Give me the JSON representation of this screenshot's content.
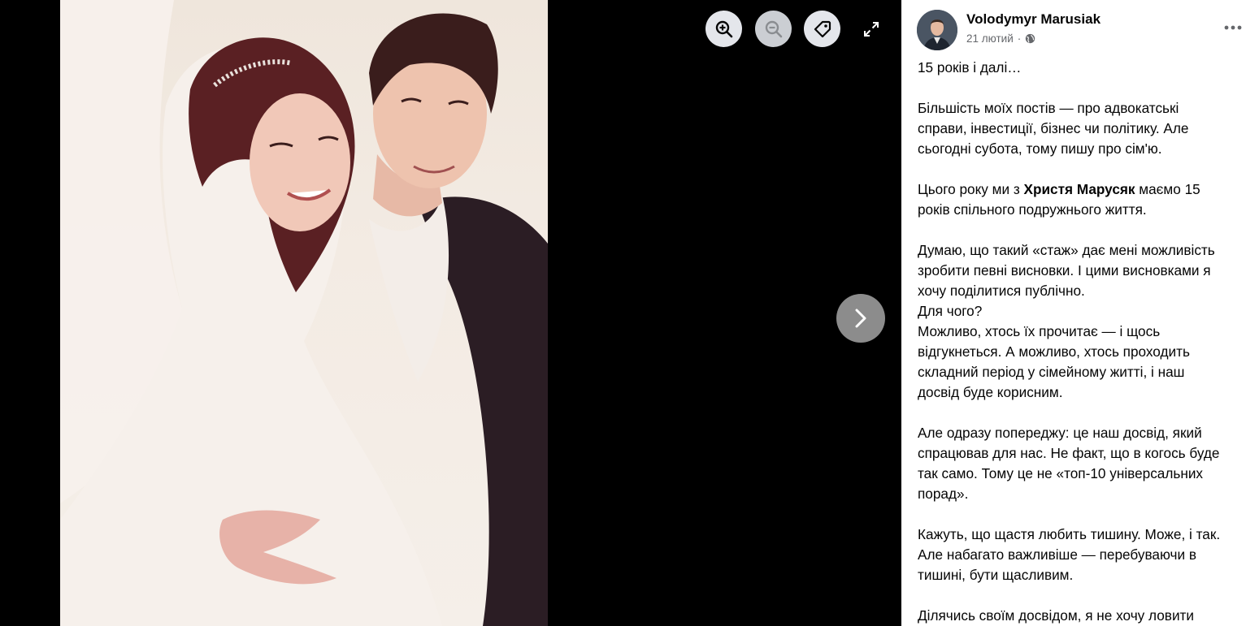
{
  "viewer": {
    "zoom_in_icon": "zoom-in-icon",
    "zoom_out_icon": "zoom-out-icon",
    "tag_icon": "tag-icon",
    "expand_icon": "expand-icon",
    "next_icon": "chevron-right-icon"
  },
  "post": {
    "author": "Volodymyr Marusiak",
    "date": "21 лютий",
    "separator": "·",
    "audience_icon": "globe-icon",
    "more_icon": "more-dots-icon",
    "lines": {
      "l1": "15 років і далі…",
      "p2_1": "Більшість моїх постів — про адвокатські",
      "p2_2": "справи, інвестиції, бізнес чи політику. Але",
      "p2_3": "сьогодні субота, тому пишу про сім'ю.",
      "p3_1a": "Цього року ми з ",
      "p3_mention": "Христя Марусяк",
      "p3_1b": " маємо 15",
      "p3_2": "років спільного подружнього життя.",
      "p4_1": "Думаю, що такий «стаж» дає мені можливість",
      "p4_2": "зробити певні висновки. І цими висновками я",
      "p4_3": "хочу поділитися публічно.",
      "p4_4": "Для чого?",
      "p4_5": "Можливо, хтось їх прочитає — і щось",
      "p4_6": "відгукнеться. А можливо, хтось проходить",
      "p4_7": "складний період у сімейному житті, і наш",
      "p4_8": "досвід буде корисним.",
      "p5_1": "Але одразу попереджу: це наш досвід, який",
      "p5_2": "спрацював для нас. Не факт, що в когось буде",
      "p5_3": "так само. Тому це не «топ-10 універсальних",
      "p5_4": "порад».",
      "p6_1": "Кажуть, що щастя любить тишину. Може, і так.",
      "p6_2": "Але набагато важливіше — перебуваючи в",
      "p6_3": "тишині, бути щасливим.",
      "p7_1": "Ділячись своїм досвідом, я не хочу ловити"
    }
  },
  "colors": {
    "viewer_bg": "#000000",
    "button_bg": "#e4e6eb",
    "text": "#050505",
    "secondary_text": "#65676b"
  }
}
